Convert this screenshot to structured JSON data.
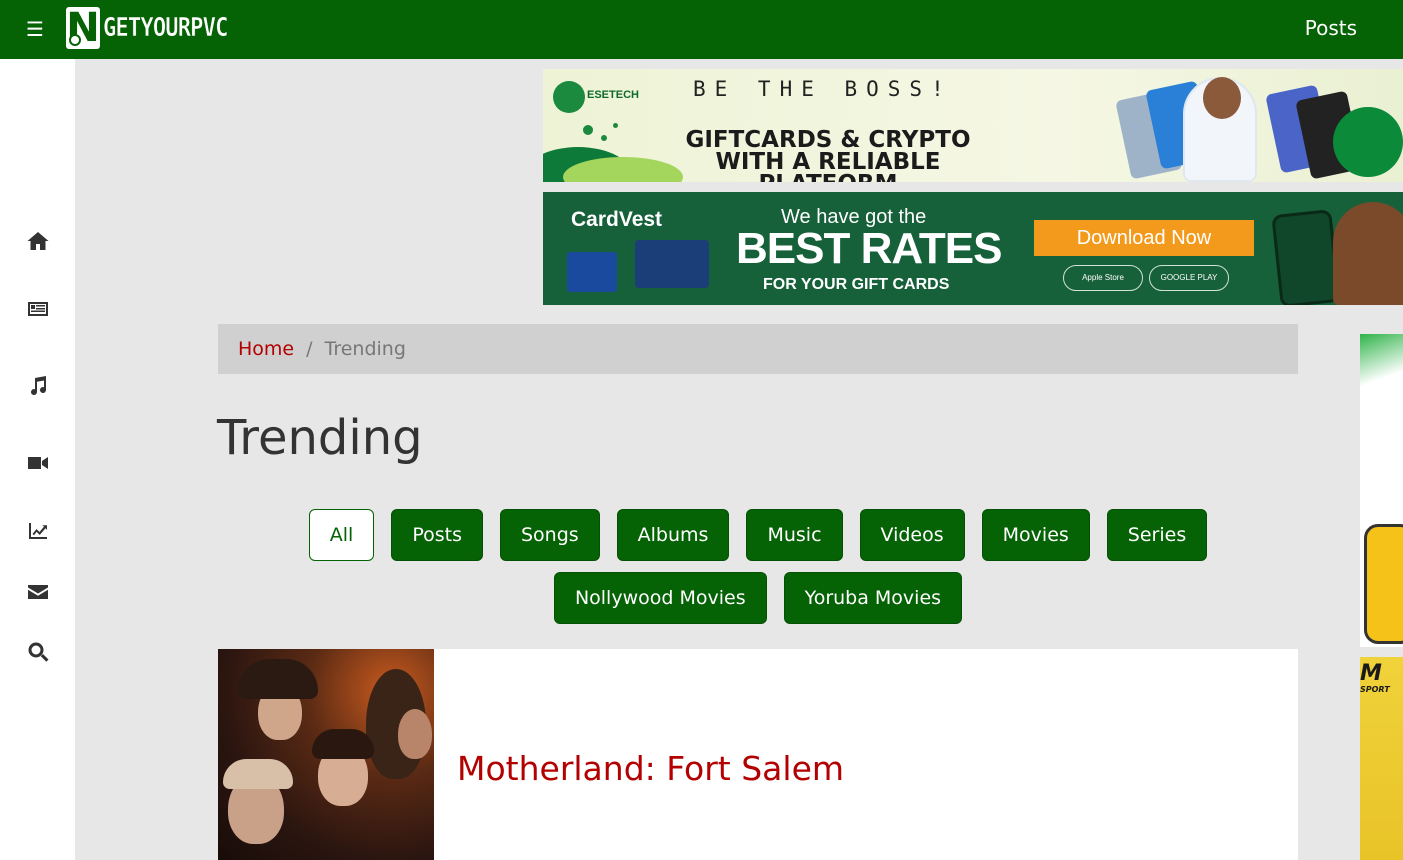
{
  "header": {
    "brand_initial": "N",
    "brand_text": "GETYOURPVC",
    "nav_posts": "Posts",
    "bg_color": "#056205"
  },
  "sidebar": {
    "items": [
      {
        "icon": "home-icon"
      },
      {
        "icon": "newspaper-icon"
      },
      {
        "icon": "music-icon"
      },
      {
        "icon": "video-icon"
      },
      {
        "icon": "chart-line-icon"
      },
      {
        "icon": "envelope-icon"
      },
      {
        "icon": "search-icon"
      }
    ]
  },
  "ads": {
    "banner1": {
      "brand": "ESETECH",
      "tagline": "BE THE BOSS!",
      "headline": "GIFTCARDS & CRYPTO WITH A RELIABLE PLATFORM"
    },
    "banner2": {
      "brand": "CardVest",
      "line1": "We have got the",
      "line2": "BEST RATES",
      "line3": "FOR YOUR GIFT CARDS",
      "cta": "Download Now",
      "store1": "Apple Store",
      "store2": "GOOGLE PLAY"
    },
    "right2": {
      "logo": "M",
      "sub": "SPORT"
    }
  },
  "breadcrumb": {
    "home": "Home",
    "separator": "/",
    "current": "Trending"
  },
  "page": {
    "title": "Trending"
  },
  "filters": [
    {
      "label": "All",
      "active": true
    },
    {
      "label": "Posts",
      "active": false
    },
    {
      "label": "Songs",
      "active": false
    },
    {
      "label": "Albums",
      "active": false
    },
    {
      "label": "Music",
      "active": false
    },
    {
      "label": "Videos",
      "active": false
    },
    {
      "label": "Movies",
      "active": false
    },
    {
      "label": "Series",
      "active": false
    },
    {
      "label": "Nollywood Movies",
      "active": false
    },
    {
      "label": "Yoruba Movies",
      "active": false
    }
  ],
  "posts": [
    {
      "title": "Motherland: Fort Salem"
    }
  ],
  "colors": {
    "primary": "#056205",
    "link_red": "#b30000",
    "page_bg": "#e7e7e7",
    "breadcrumb_bg": "#d0d0d0"
  }
}
